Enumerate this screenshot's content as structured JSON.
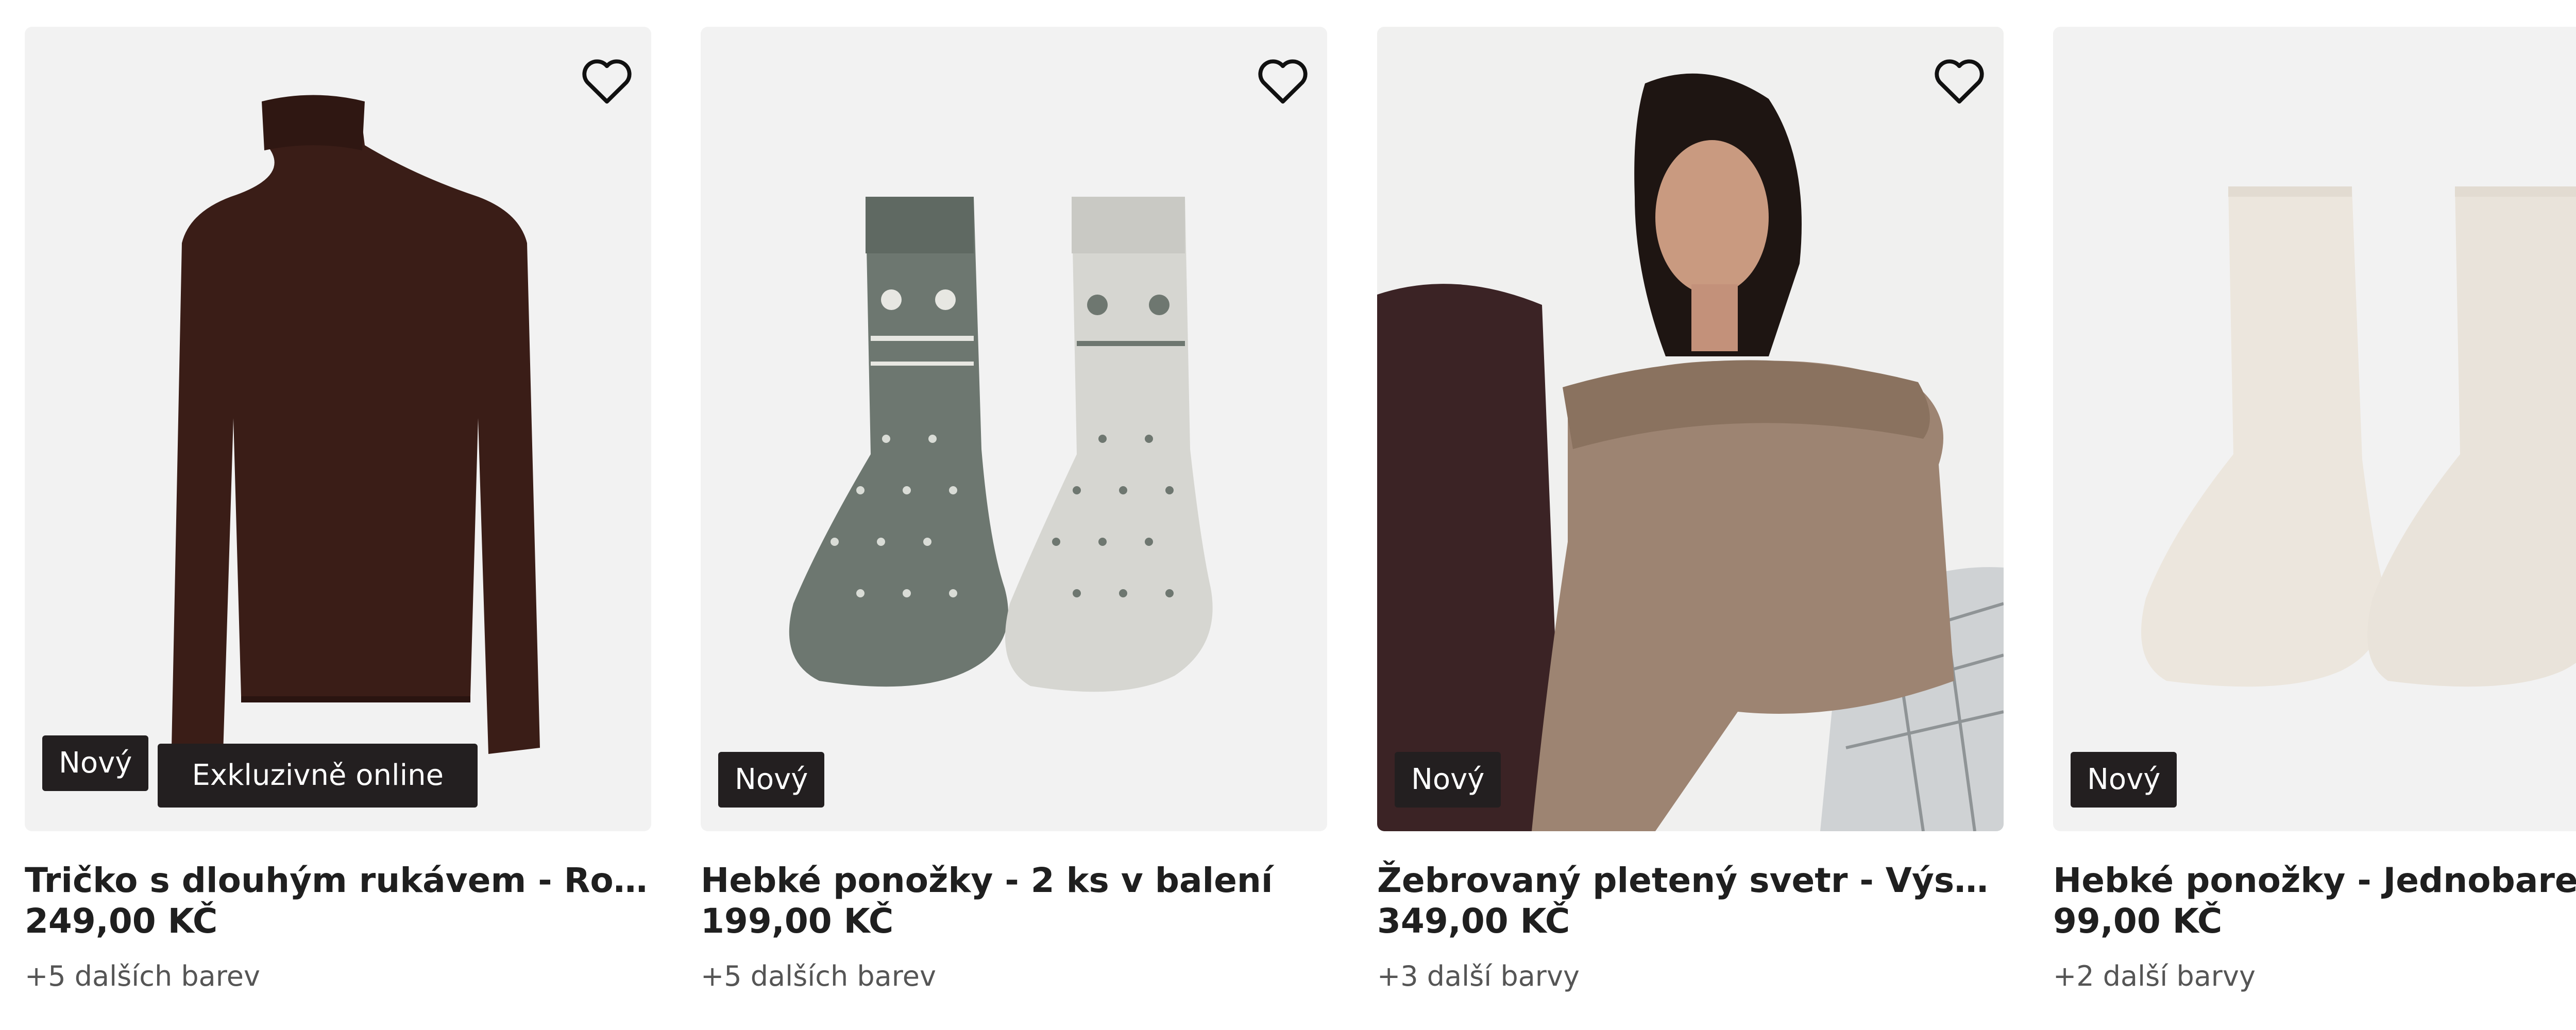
{
  "products": [
    {
      "title": "Tričko s dlouhým rukávem - Rolákový límec",
      "price": "249,00 KČ",
      "colors": "+5 dalších barev",
      "badge_new": "Nový",
      "badge_online": "Exkluzivně online",
      "image": "brown-turtleneck-top"
    },
    {
      "title": "Hebké ponožky - 2 ks v balení",
      "price": "199,00 KČ",
      "colors": "+5 dalších barev",
      "badge_new": "Nový",
      "image": "nordic-pattern-socks"
    },
    {
      "title": "Žebrovaný pletený svetr - Výstřih ve stylu carmen",
      "price": "349,00 KČ",
      "colors": "+3 další barvy",
      "badge_new": "Nový",
      "image": "ribbed-knit-sweater-model"
    },
    {
      "title": "Hebké ponožky - Jednobarevné",
      "price": "99,00 KČ",
      "colors": "+2 další barvy",
      "badge_new": "Nový",
      "image": "plain-cream-socks"
    }
  ],
  "icons": {
    "favorite": "heart-outline-icon"
  },
  "colors": {
    "badge_bg": "#231f20",
    "tile_bg": "#f2f2f2"
  }
}
